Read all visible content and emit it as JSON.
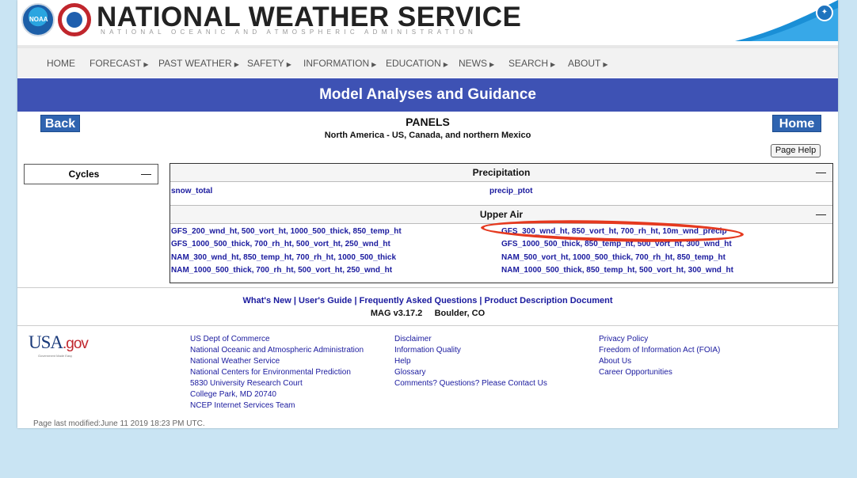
{
  "header": {
    "title": "NATIONAL WEATHER SERVICE",
    "subtitle": "NATIONAL OCEANIC AND ATMOSPHERIC ADMINISTRATION",
    "noaa_logo_text": "NOAA"
  },
  "nav": {
    "items": [
      {
        "label": "HOME",
        "has_menu": false
      },
      {
        "label": "FORECAST",
        "has_menu": true
      },
      {
        "label": "PAST WEATHER",
        "has_menu": true
      },
      {
        "label": "SAFETY",
        "has_menu": true
      },
      {
        "label": "INFORMATION",
        "has_menu": true
      },
      {
        "label": "EDUCATION",
        "has_menu": true
      },
      {
        "label": "NEWS",
        "has_menu": true
      },
      {
        "label": "SEARCH",
        "has_menu": true
      },
      {
        "label": "ABOUT",
        "has_menu": true
      }
    ],
    "arrow_glyph": "▶"
  },
  "banner": {
    "title": "Model Analyses and Guidance"
  },
  "buttons": {
    "back": "Back",
    "home": "Home",
    "page_help": "Page Help"
  },
  "panels": {
    "title": "PANELS",
    "subtitle": "North America - US, Canada, and northern Mexico"
  },
  "cycles": {
    "label": "Cycles",
    "toggle": "—"
  },
  "precipitation": {
    "label": "Precipitation",
    "toggle": "—",
    "links": [
      "snow_total",
      "precip_ptot"
    ]
  },
  "upper_air": {
    "label": "Upper Air",
    "toggle": "—",
    "left_links": [
      "GFS_200_wnd_ht, 500_vort_ht, 1000_500_thick, 850_temp_ht",
      "GFS_1000_500_thick, 700_rh_ht, 500_vort_ht, 250_wnd_ht",
      "NAM_300_wnd_ht, 850_temp_ht, 700_rh_ht, 1000_500_thick",
      "NAM_1000_500_thick, 700_rh_ht, 500_vort_ht, 250_wnd_ht"
    ],
    "right_links": [
      "GFS_300_wnd_ht, 850_vort_ht, 700_rh_ht, 10m_wnd_precip",
      "GFS_1000_500_thick, 850_temp_ht, 500_vort_ht, 300_wnd_ht",
      "NAM_500_vort_ht, 1000_500_thick, 700_rh_ht, 850_temp_ht",
      "NAM_1000_500_thick, 850_temp_ht, 500_vort_ht, 300_wnd_ht"
    ]
  },
  "footer": {
    "links": [
      "What's New",
      "User's Guide",
      "Frequently Asked Questions",
      "Product Description Document"
    ],
    "separator": " | ",
    "version": "MAG v3.17.2",
    "location": "Boulder, CO",
    "usagov": {
      "usa": "USA",
      "gov": ".gov",
      "tagline": "Government Made Easy"
    },
    "col1": [
      "US Dept of Commerce",
      "National Oceanic and Atmospheric Administration",
      "National Weather Service",
      "National Centers for Environmental Prediction",
      "5830 University Research Court",
      "College Park, MD 20740",
      "NCEP Internet Services Team"
    ],
    "col2": [
      "Disclaimer",
      "Information Quality",
      "Help",
      "Glossary",
      "Comments? Questions? Please Contact Us"
    ],
    "col3": [
      "Privacy Policy",
      "Freedom of Information Act (FOIA)",
      "About Us",
      "Career Opportunities"
    ],
    "modified": "Page last modified:June 11 2019 18:23 PM UTC."
  },
  "colors": {
    "banner": "#3e52b4",
    "button": "#2f64b0",
    "link": "#1a1a9e",
    "annotation": "#e5391f",
    "background": "#c9e4f3"
  }
}
